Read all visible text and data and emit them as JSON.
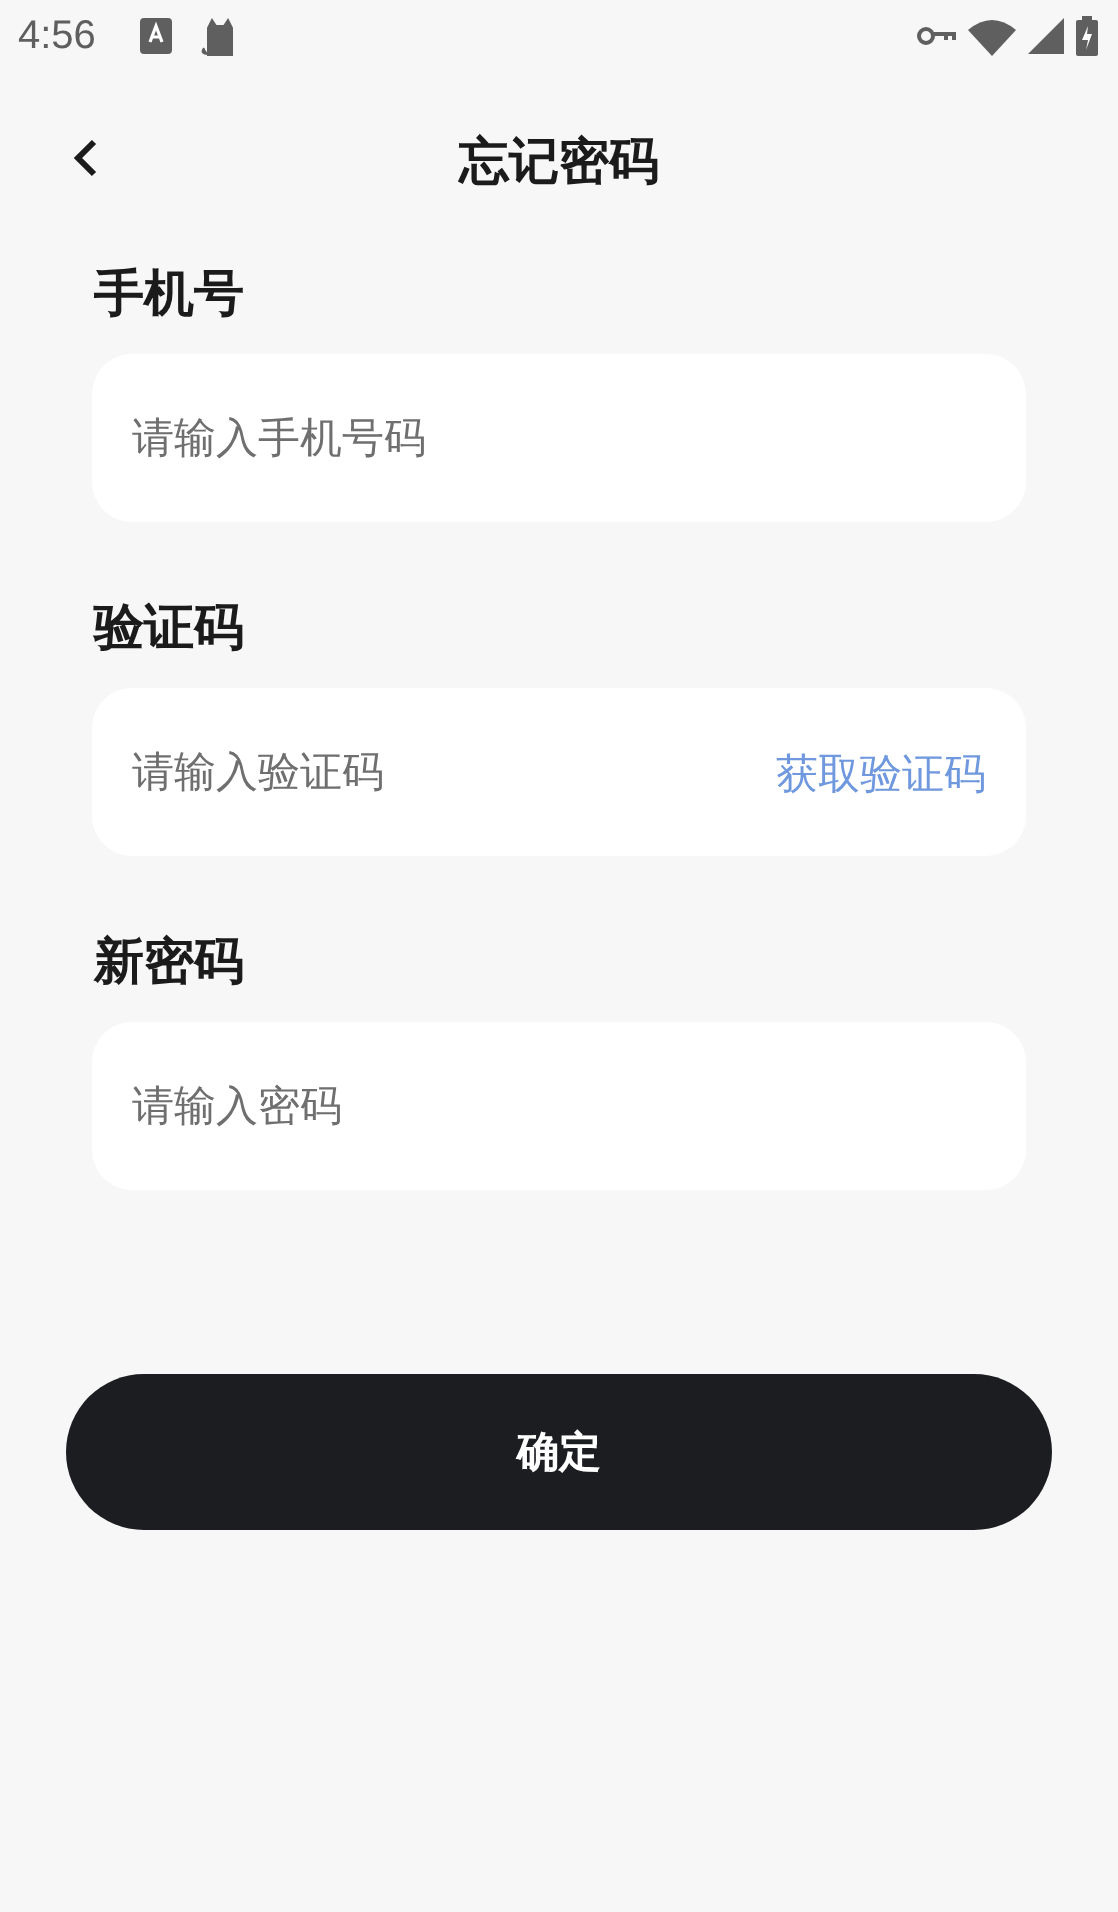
{
  "status_bar": {
    "time": "4:56"
  },
  "header": {
    "title": "忘记密码"
  },
  "fields": [
    {
      "label": "手机号",
      "placeholder": "请输入手机号码"
    },
    {
      "label": "验证码",
      "placeholder": "请输入验证码",
      "action": "获取验证码"
    },
    {
      "label": "新密码",
      "placeholder": "请输入密码"
    }
  ],
  "submit_button": "确定"
}
